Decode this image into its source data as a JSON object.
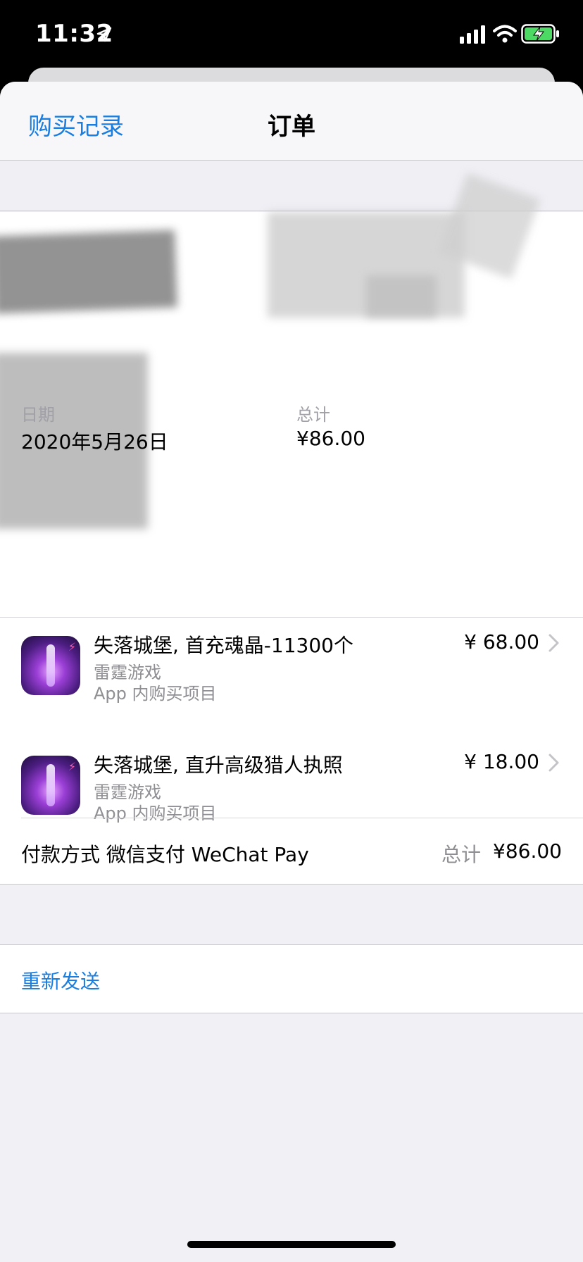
{
  "status_bar": {
    "time": "11:32"
  },
  "nav": {
    "back_label": "购买记录",
    "title": "订单"
  },
  "details": {
    "date_label": "日期",
    "date_value": "2020年5月26日",
    "total_label": "总计",
    "total_value": "¥86.00"
  },
  "items": [
    {
      "title": "失落城堡, 首充魂晶-11300个",
      "developer": "雷霆游戏",
      "type": "App 内购买项目",
      "price": "¥ 68.00"
    },
    {
      "title": "失落城堡, 直升高级猎人执照",
      "developer": "雷霆游戏",
      "type": "App 内购买项目",
      "price": "¥ 18.00"
    }
  ],
  "payment": {
    "method": "付款方式 微信支付 WeChat Pay",
    "total_label": "总计",
    "total_value": "¥86.00"
  },
  "actions": {
    "resend_label": "重新发送"
  },
  "colors": {
    "accent": "#1a7ee0",
    "secondary_text": "#8e8e93",
    "background": "#f0f0f5"
  },
  "icons": [
    "location-arrow-icon",
    "cellular-signal-icon",
    "wifi-icon",
    "battery-charging-icon",
    "chevron-right-icon"
  ]
}
